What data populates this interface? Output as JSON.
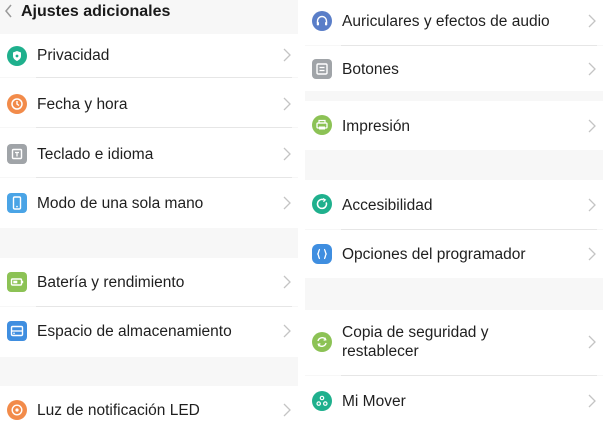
{
  "header": {
    "title": "Ajustes adicionales"
  },
  "left": {
    "items": [
      {
        "label": "Privacidad",
        "icon": "shield-icon",
        "color": "#1fb08d"
      },
      {
        "label": "Fecha y hora",
        "icon": "clock-icon",
        "color": "#f28b4a"
      },
      {
        "label": "Teclado e idioma",
        "icon": "keyboard-icon",
        "color": "#a0a4a8"
      },
      {
        "label": "Modo de una sola mano",
        "icon": "phone-icon",
        "color": "#4aa4e6"
      },
      {
        "label": "Batería y rendimiento",
        "icon": "battery-icon",
        "color": "#8cc255"
      },
      {
        "label": "Espacio de almacenamiento",
        "icon": "storage-icon",
        "color": "#3f8ee0"
      },
      {
        "label": "Luz de notificación LED",
        "icon": "led-icon",
        "color": "#f28b4a"
      }
    ]
  },
  "right": {
    "items": [
      {
        "label": "Auriculares y efectos de audio",
        "icon": "headphones-icon",
        "color": "#5a7ec8"
      },
      {
        "label": "Botones",
        "icon": "buttons-icon",
        "color": "#a0a4a8"
      },
      {
        "label": "Impresión",
        "icon": "printer-icon",
        "color": "#8cc255"
      },
      {
        "label": "Accesibilidad",
        "icon": "accessibility-icon",
        "color": "#1fb08d"
      },
      {
        "label": "Opciones del programador",
        "icon": "code-icon",
        "color": "#3f8ee0"
      },
      {
        "label_line1": "Copia de seguridad y",
        "label_line2": "restablecer",
        "icon": "backup-icon",
        "color": "#8cc255"
      },
      {
        "label": "Mi Mover",
        "icon": "mi-mover-icon",
        "color": "#1fb08d"
      }
    ]
  }
}
